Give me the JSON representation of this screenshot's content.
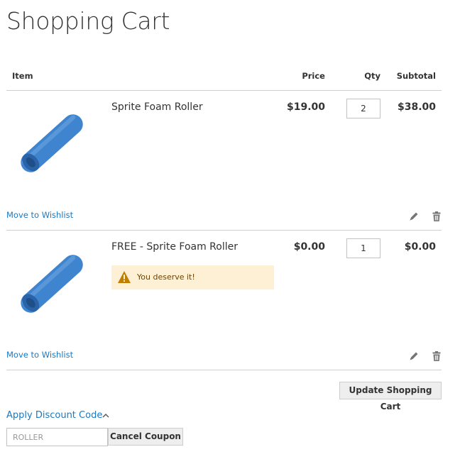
{
  "page_title": "Shopping Cart",
  "table": {
    "headers": {
      "item": "Item",
      "price": "Price",
      "qty": "Qty",
      "subtotal": "Subtotal"
    }
  },
  "items": [
    {
      "name": "Sprite Foam Roller",
      "price": "$19.00",
      "qty": "2",
      "subtotal": "$38.00",
      "wishlist": "Move to Wishlist",
      "image_icon": "foam-roller-image"
    },
    {
      "name": "FREE - Sprite Foam Roller",
      "price": "$0.00",
      "qty": "1",
      "subtotal": "$0.00",
      "wishlist": "Move to Wishlist",
      "image_icon": "foam-roller-image",
      "notice": "You deserve it!"
    }
  ],
  "actions": {
    "update_cart": "Update Shopping Cart"
  },
  "discount": {
    "label": "Apply Discount Code",
    "coupon_value": "ROLLER",
    "cancel_label": "Cancel Coupon"
  },
  "colors": {
    "link": "#1979c3",
    "notice_bg": "#fdf0d5",
    "warning_icon": "#c07f00",
    "roller": "#3f84cf"
  }
}
